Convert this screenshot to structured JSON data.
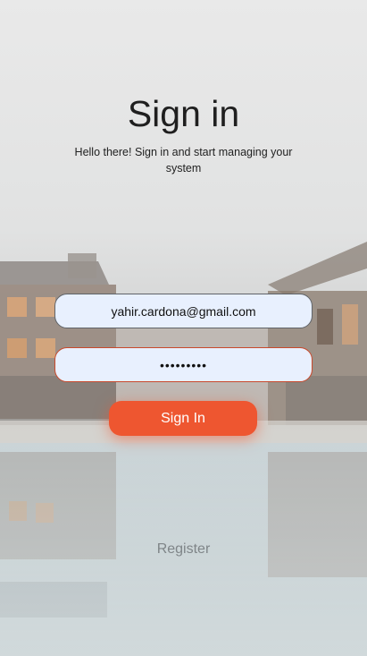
{
  "login": {
    "title": "Sign in",
    "subtitle": "Hello there! Sign in and start managing your system",
    "email_value": "yahir.cardona@gmail.com",
    "password_value": "•••••••••",
    "signin_label": "Sign In",
    "register_label": "Register"
  },
  "colors": {
    "accent": "#ee5630",
    "input_bg": "#e8f0fe",
    "title": "#1f1f1f",
    "register": "#7f8588"
  }
}
